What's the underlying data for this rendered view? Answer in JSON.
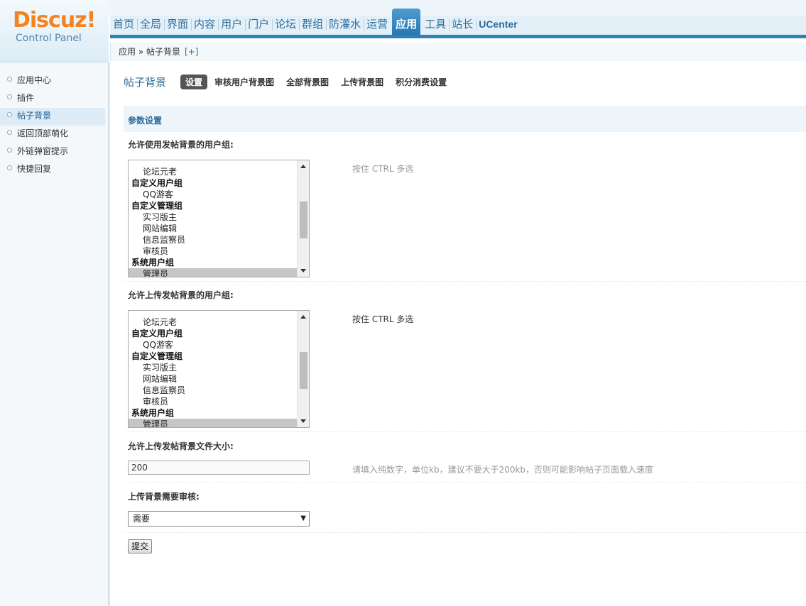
{
  "logo": {
    "name": "Discuz!",
    "subtitle": "Control Panel"
  },
  "nav": {
    "items": [
      "首页",
      "全局",
      "界面",
      "内容",
      "用户",
      "门户",
      "论坛",
      "群组",
      "防灌水",
      "运营",
      "应用",
      "工具",
      "站长",
      "UCenter"
    ],
    "active": "应用"
  },
  "breadcrumb": {
    "path": "应用 » 帖子背景",
    "add": "[+]"
  },
  "sidebar": {
    "items": [
      {
        "label": "应用中心"
      },
      {
        "label": "插件"
      },
      {
        "label": "帖子背景"
      },
      {
        "label": "返回顶部萌化"
      },
      {
        "label": "外链弹窗提示"
      },
      {
        "label": "快捷回复"
      }
    ],
    "active_index": 2
  },
  "page": {
    "plugin_title": "帖子背景",
    "tabs": [
      "设置",
      "审核用户背景图",
      "全部背景图",
      "上传背景图",
      "积分消费设置"
    ],
    "active_tab": "设置",
    "section_title": "参数设置"
  },
  "form": {
    "use_groups": {
      "label": "允许使用发帖背景的用户组:",
      "hint": "按住 CTRL 多选",
      "options": [
        {
          "type": "opt",
          "text": "论坛元老"
        },
        {
          "type": "grp",
          "text": "自定义用户组"
        },
        {
          "type": "opt",
          "text": "QQ游客"
        },
        {
          "type": "grp",
          "text": "自定义管理组"
        },
        {
          "type": "opt",
          "text": "实习版主"
        },
        {
          "type": "opt",
          "text": "网站编辑"
        },
        {
          "type": "opt",
          "text": "信息监察员"
        },
        {
          "type": "opt",
          "text": "审核员"
        },
        {
          "type": "grp",
          "text": "系统用户组"
        },
        {
          "type": "opt",
          "text": "管理员",
          "selected": true
        }
      ]
    },
    "upload_groups": {
      "label": "允许上传发帖背景的用户组:",
      "hint": "按住 CTRL 多选",
      "options": [
        {
          "type": "opt",
          "text": "论坛元老"
        },
        {
          "type": "grp",
          "text": "自定义用户组"
        },
        {
          "type": "opt",
          "text": "QQ游客"
        },
        {
          "type": "grp",
          "text": "自定义管理组"
        },
        {
          "type": "opt",
          "text": "实习版主"
        },
        {
          "type": "opt",
          "text": "网站编辑"
        },
        {
          "type": "opt",
          "text": "信息监察员"
        },
        {
          "type": "opt",
          "text": "审核员"
        },
        {
          "type": "grp",
          "text": "系统用户组"
        },
        {
          "type": "opt",
          "text": "管理员",
          "selected": true
        }
      ]
    },
    "file_size": {
      "label": "允许上传发帖背景文件大小:",
      "value": "200",
      "hint": "请填入纯数字，单位kb，建议不要大于200kb，否则可能影响帖子页面载入速度"
    },
    "review": {
      "label": "上传背景需要审核:",
      "value": "需要"
    },
    "submit_label": "提交"
  }
}
